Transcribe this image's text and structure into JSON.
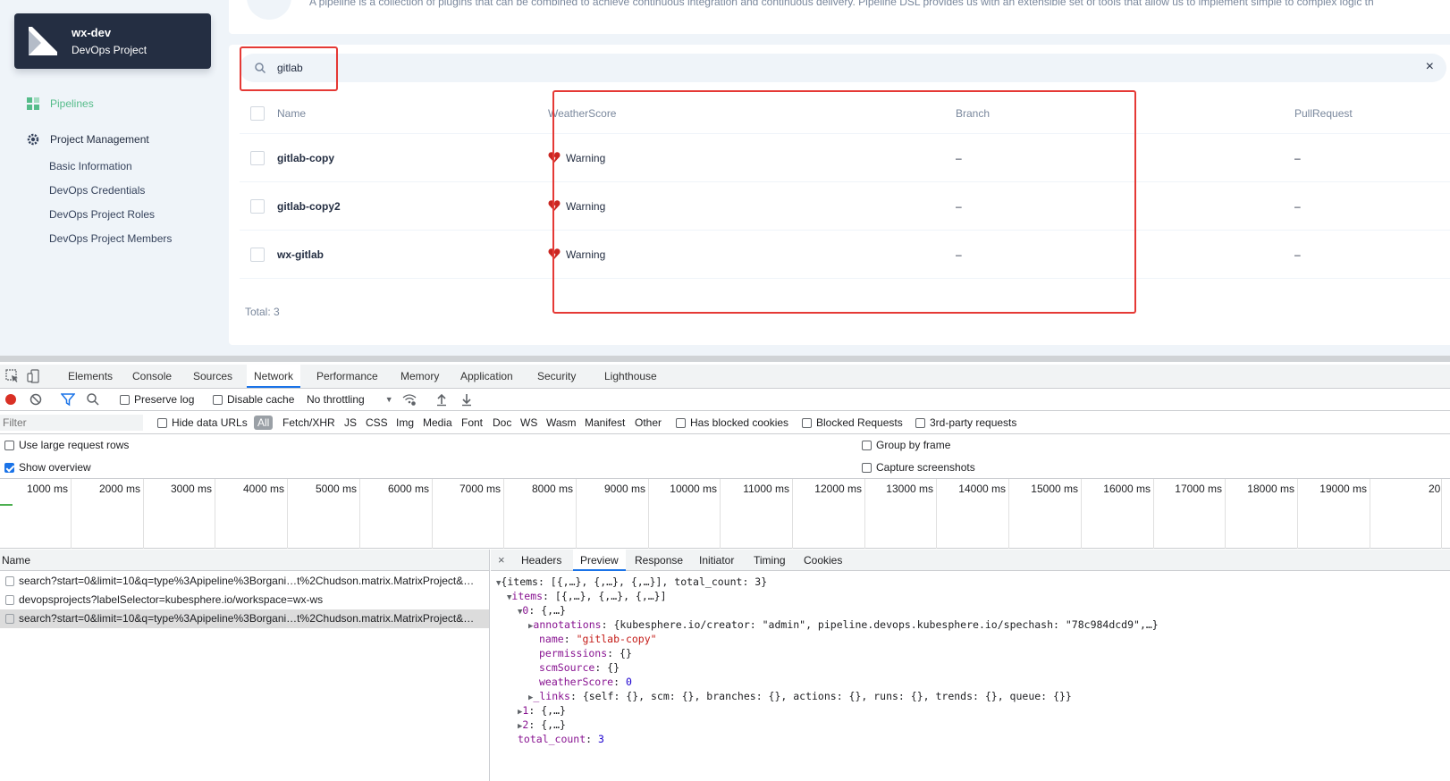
{
  "sidebar": {
    "project_name": "wx-dev",
    "project_type": "DevOps Project",
    "nav": {
      "pipelines": "Pipelines",
      "project_management": "Project Management"
    },
    "sub_items": [
      "Basic Information",
      "DevOps Credentials",
      "DevOps Project Roles",
      "DevOps Project Members"
    ]
  },
  "banner": {
    "description": "A pipeline is a collection of plugins that can be combined to achieve continuous integration and continuous delivery. Pipeline DSL provides us with an extensible set of tools that allow us to implement simple to complex logic th"
  },
  "search": {
    "value": "gitlab",
    "clear": "×"
  },
  "table": {
    "headers": {
      "name": "Name",
      "weather": "WeatherScore",
      "branch": "Branch",
      "pull": "PullRequest"
    },
    "rows": [
      {
        "name": "gitlab-copy",
        "weather": "Warning",
        "branch": "–",
        "pull": "–"
      },
      {
        "name": "gitlab-copy2",
        "weather": "Warning",
        "branch": "–",
        "pull": "–"
      },
      {
        "name": "wx-gitlab",
        "weather": "Warning",
        "branch": "–",
        "pull": "–"
      }
    ],
    "total": "Total: 3"
  },
  "devtools": {
    "tabs": [
      "Elements",
      "Console",
      "Sources",
      "Network",
      "Performance",
      "Memory",
      "Application",
      "Security",
      "Lighthouse"
    ],
    "active_tab": "Network",
    "toolbar": {
      "preserve_log": "Preserve log",
      "disable_cache": "Disable cache",
      "throttling": "No throttling"
    },
    "filter": {
      "placeholder": "Filter",
      "hide_data_urls": "Hide data URLs",
      "all": "All",
      "types": [
        "Fetch/XHR",
        "JS",
        "CSS",
        "Img",
        "Media",
        "Font",
        "Doc",
        "WS",
        "Wasm",
        "Manifest",
        "Other"
      ],
      "has_blocked_cookies": "Has blocked cookies",
      "blocked_requests": "Blocked Requests",
      "third_party": "3rd-party requests"
    },
    "options": {
      "large_rows": "Use large request rows",
      "show_overview": "Show overview",
      "group_by_frame": "Group by frame",
      "capture_screenshots": "Capture screenshots"
    },
    "timeline": [
      "1000 ms",
      "2000 ms",
      "3000 ms",
      "4000 ms",
      "5000 ms",
      "6000 ms",
      "7000 ms",
      "8000 ms",
      "9000 ms",
      "10000 ms",
      "11000 ms",
      "12000 ms",
      "13000 ms",
      "14000 ms",
      "15000 ms",
      "16000 ms",
      "17000 ms",
      "18000 ms",
      "19000 ms",
      "20"
    ],
    "requests_header": "Name",
    "requests": [
      "search?start=0&limit=10&q=type%3Apipeline%3Borgani…t%2Chudson.matrix.MatrixProject&…",
      "devopsprojects?labelSelector=kubesphere.io/workspace=wx-ws",
      "search?start=0&limit=10&q=type%3Apipeline%3Borgani…t%2Chudson.matrix.MatrixProject&…"
    ],
    "preview_tabs": [
      "Headers",
      "Preview",
      "Response",
      "Initiator",
      "Timing",
      "Cookies"
    ],
    "preview_close": "×",
    "json": {
      "root": "{items: [{,…}, {,…}, {,…}], total_count: 3}",
      "items_key": "items",
      "items_val": "[{,…}, {,…}, {,…}]",
      "item0_key": "0",
      "item0_val": "{,…}",
      "annotations_key": "annotations",
      "annotations_val": "{kubesphere.io/creator: \"admin\", pipeline.devops.kubesphere.io/spechash: \"78c984dcd9\",…}",
      "name_key": "name",
      "name_val": "\"gitlab-copy\"",
      "permissions_key": "permissions",
      "permissions_val": "{}",
      "scm_key": "scmSource",
      "scm_val": "{}",
      "weather_key": "weatherScore",
      "weather_val": "0",
      "links_key": "_links",
      "links_val": "{self: {}, scm: {}, branches: {}, actions: {}, runs: {}, trends: {}, queue: {}}",
      "item1_key": "1",
      "item1_val": "{,…}",
      "item2_key": "2",
      "item2_val": "{,…}",
      "total_key": "total_count",
      "total_val": "3"
    }
  }
}
